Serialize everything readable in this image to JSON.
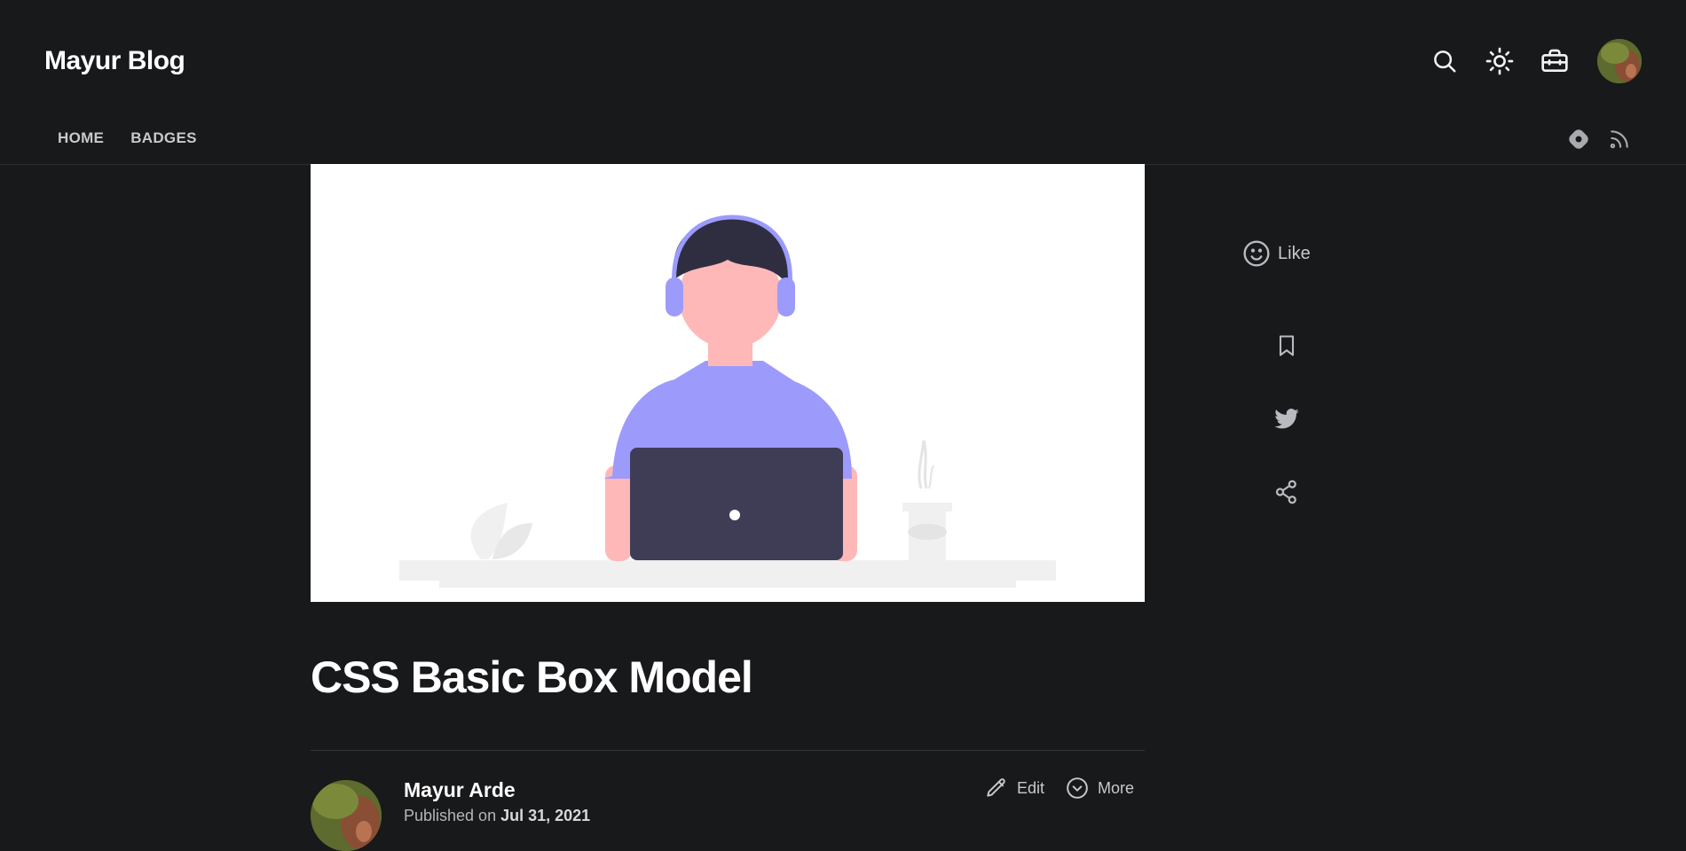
{
  "header": {
    "blog_title": "Mayur Blog",
    "icons": [
      "search-icon",
      "sun-icon",
      "toolbox-icon"
    ]
  },
  "nav": {
    "items": [
      {
        "label": "HOME"
      },
      {
        "label": "BADGES"
      }
    ],
    "right_icons": [
      "hashnode-icon",
      "rss-icon"
    ]
  },
  "sidebar_actions": {
    "like_label": "Like",
    "icons": [
      "bookmark-icon",
      "twitter-icon",
      "share-icon"
    ]
  },
  "post": {
    "title": "CSS Basic Box Model",
    "author": "Mayur Arde",
    "published_prefix": "Published on",
    "published_date": "Jul 31, 2021",
    "edit_label": "Edit",
    "more_label": "More"
  },
  "colors": {
    "background": "#18191b",
    "illustration_purple": "#9c9bfc",
    "illustration_dark": "#3f3d56",
    "illustration_skin": "#ffb8b8"
  }
}
